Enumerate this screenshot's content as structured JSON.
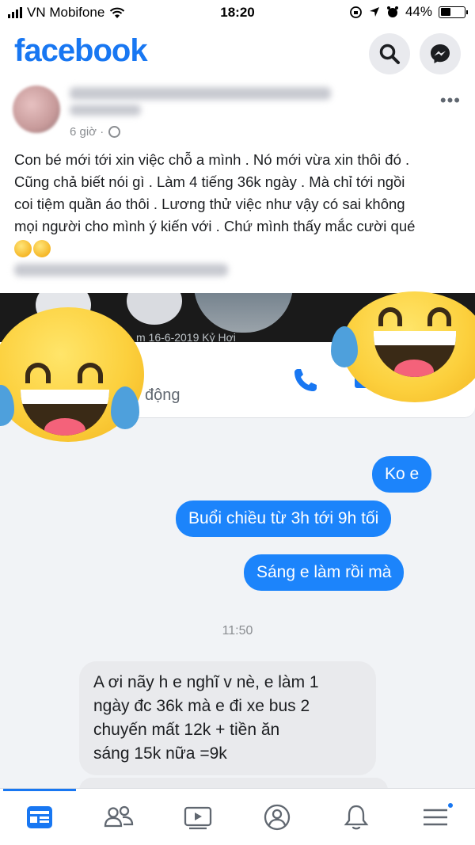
{
  "status_bar": {
    "carrier": "VN Mobifone",
    "time": "18:20",
    "battery": "44%",
    "battery_level": 0.44
  },
  "header": {
    "logo": "facebook",
    "search_icon": "search-icon",
    "messenger_icon": "messenger-icon"
  },
  "post": {
    "time": "6 giờ ·",
    "more": "•••",
    "text_lines": [
      "Con bé mới tới xin việc chỗ a mình . Nó mới vừa xin thôi đó .",
      "Cũng chả biết nói gì . Làm 4 tiếng 36k ngày . Mà chỉ tới ngồi",
      "coi tiệm quần áo thôi . Lương thử việc như vậy có sai không",
      "mọi người cho mình ý kiến với . Chứ mình thấy mắc cười qué"
    ]
  },
  "screenshot": {
    "date_text": "m 16-6-2019 Kỷ Hợi",
    "active_text": "động",
    "messages_out": [
      "Ko e",
      "Buổi chiều từ 3h tới 9h tối",
      "Sáng e làm rồi mà"
    ],
    "time_label": "11:50",
    "message_in_lines": [
      "A ơi nãy h e nghĩ v nè, e làm 1",
      "ngày đc 36k mà e đi xe bus 2",
      "chuyến mất 12k + tiền ăn",
      "sáng 15k nữa =9k"
    ]
  },
  "colors": {
    "brand": "#1877f2",
    "outgoing_bubble": "#1c84fb",
    "incoming_bubble": "#e9eaed"
  },
  "bottom_nav": {
    "items": [
      "news-feed-icon",
      "friends-icon",
      "watch-icon",
      "profile-icon",
      "notifications-icon",
      "menu-icon"
    ],
    "active": "news-feed-icon"
  }
}
